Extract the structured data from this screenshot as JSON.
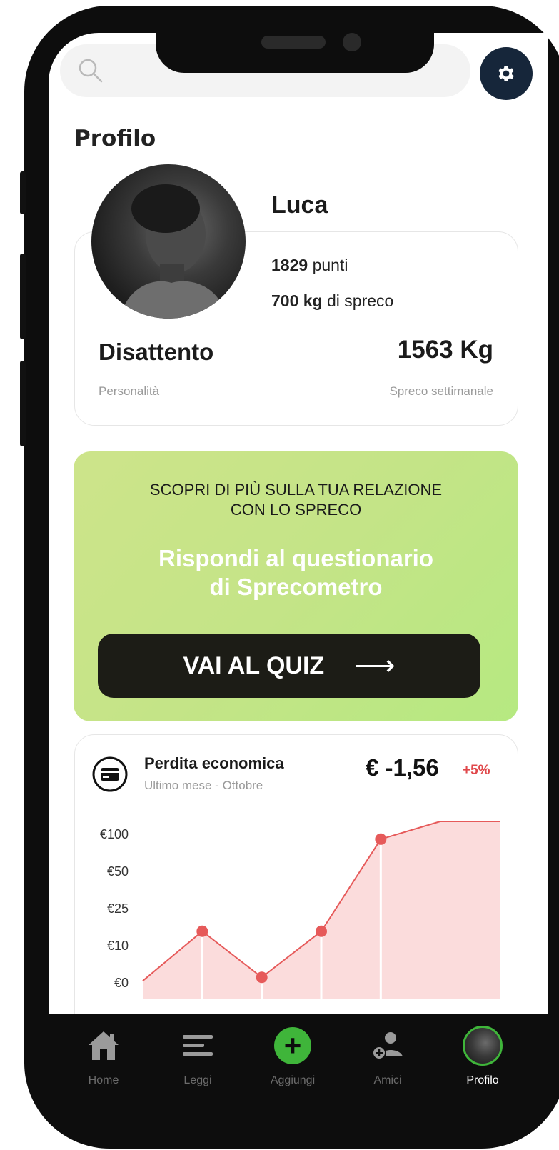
{
  "topbar": {
    "search_icon": "search-icon",
    "settings_icon": "gear-icon"
  },
  "page": {
    "title": "Profilo"
  },
  "profile": {
    "name": "Luca",
    "points_value": "1829",
    "points_unit": "punti",
    "waste_value": "700 kg",
    "waste_unit": "di spreco",
    "personality": "Disattento",
    "personality_label": "Personalità",
    "weekly_waste": "1563 Kg",
    "weekly_waste_label": "Spreco settimanale"
  },
  "quiz": {
    "kicker_line1": "SCOPRI DI PIÙ SULLA TUA RELAZIONE",
    "kicker_line2": "CON LO SPRECO",
    "headline_line1": "Rispondi al questionario",
    "headline_line2": "di Sprecometro",
    "button_label": "VAI AL QUIZ",
    "button_arrow": "⟶"
  },
  "economic_card": {
    "icon": "credit-card-icon",
    "title": "Perdita economica",
    "subtitle": "Ultimo mese - Ottobre",
    "amount": "€ -1,56",
    "change": "+5%"
  },
  "chart_data": {
    "type": "area",
    "title": "Perdita economica",
    "y_ticks": [
      "€100",
      "€50",
      "€25",
      "€10",
      "€0"
    ],
    "x": [
      0,
      1,
      2,
      3,
      4,
      5,
      6
    ],
    "values": [
      10,
      38,
      12,
      38,
      90,
      100,
      100
    ],
    "marked_points": [
      1,
      2,
      3,
      4
    ],
    "ylim": [
      0,
      100
    ],
    "grid": false,
    "line_color": "#e65a5a",
    "fill_color": "#fbdcdc"
  },
  "nav": {
    "items": [
      {
        "label": "Home",
        "icon": "home-icon",
        "active": false
      },
      {
        "label": "Leggi",
        "icon": "menu-lines-icon",
        "active": false
      },
      {
        "label": "Aggiungi",
        "icon": "add-icon",
        "active": false
      },
      {
        "label": "Amici",
        "icon": "add-friend-icon",
        "active": false
      },
      {
        "label": "Profilo",
        "icon": "profile-avatar-icon",
        "active": true
      }
    ],
    "add_symbol": "+"
  },
  "colors": {
    "accent_green": "#3fb53a",
    "quiz_gradient_start": "#cde48a",
    "quiz_gradient_end": "#b6e981",
    "negative_red": "#e0484b",
    "settings_bg": "#16263a"
  }
}
